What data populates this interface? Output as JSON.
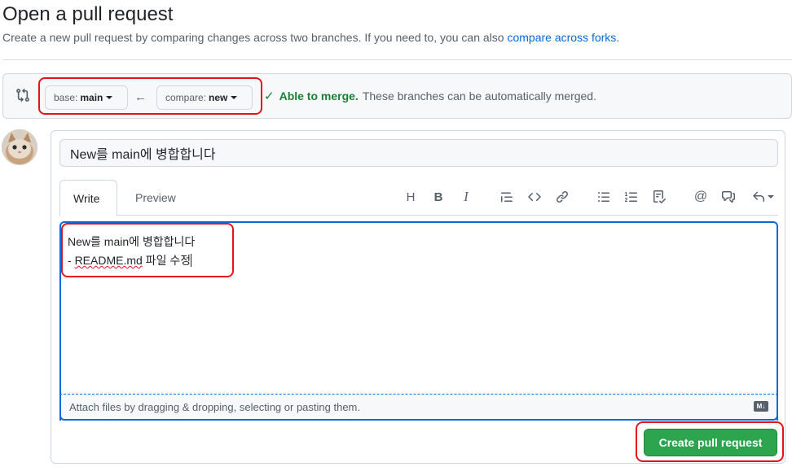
{
  "header": {
    "title": "Open a pull request",
    "subtitle": "Create a new pull request by comparing changes across two branches. If you need to, you can also",
    "subtitle_link": "compare across forks",
    "subtitle_end": "."
  },
  "range": {
    "base_prefix": "base:",
    "base_branch": "main",
    "compare_prefix": "compare:",
    "compare_branch": "new",
    "merge_ok": "Able to merge.",
    "merge_msg": "These branches can be automatically merged."
  },
  "composer": {
    "title_value": "New를 main에 병합합니다",
    "tabs": [
      {
        "label": "Write",
        "active": true
      },
      {
        "label": "Preview",
        "active": false
      }
    ],
    "toolbar_icons": [
      "heading-icon",
      "bold-icon",
      "italic-icon",
      "quote-icon",
      "code-icon",
      "link-icon",
      "unordered-list-icon",
      "ordered-list-icon",
      "task-list-icon",
      "mention-icon",
      "reference-icon",
      "reply-icon"
    ],
    "body_line1": "New를 main에 병합합니다",
    "body_line2_prefix": "- ",
    "body_line2_link": "README.md",
    "body_line2_suffix": " 파일 수정",
    "attach_hint": "Attach files by dragging & dropping, selecting or pasting them.",
    "markdown_badge": "M↓"
  },
  "actions": {
    "create_label": "Create pull request"
  },
  "colors": {
    "accent_blue": "#0969da",
    "success_green": "#1a7f37",
    "button_green": "#2da44e",
    "highlight_red": "#e5141b"
  }
}
